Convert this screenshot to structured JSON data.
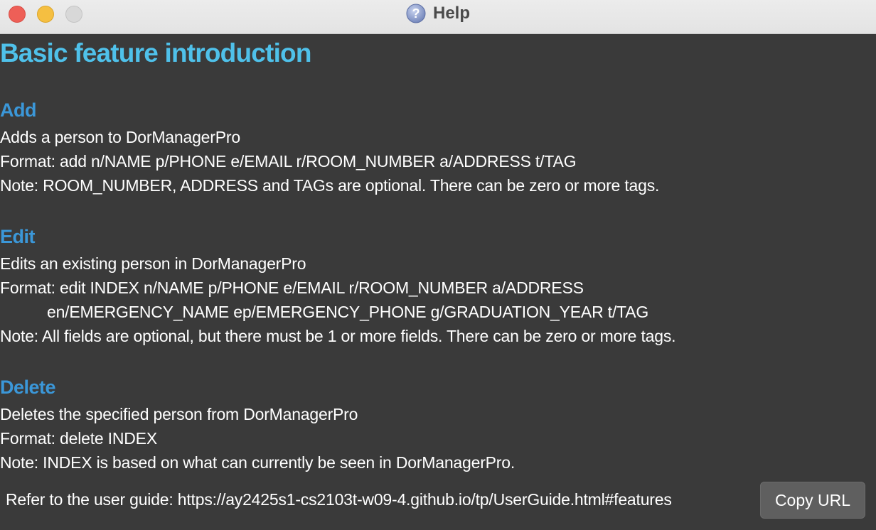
{
  "window": {
    "title": "Help",
    "icon": "help-question-icon"
  },
  "colors": {
    "page_title": "#4fc1ea",
    "section_heading": "#3b97d8",
    "background": "#3a3a3a",
    "text": "#ffffff",
    "button_bg": "#5f5f5f"
  },
  "content": {
    "title": "Basic feature introduction",
    "sections": [
      {
        "heading": "Add",
        "lines": [
          "Adds a person to DorManagerPro",
          "Format: add n/NAME p/PHONE e/EMAIL r/ROOM_NUMBER a/ADDRESS t/TAG",
          "Note: ROOM_NUMBER, ADDRESS and TAGs are optional. There can be zero or more tags."
        ]
      },
      {
        "heading": "Edit",
        "lines": [
          "Edits an existing person in DorManagerPro",
          "Format: edit INDEX n/NAME p/PHONE e/EMAIL r/ROOM_NUMBER a/ADDRESS",
          "en/EMERGENCY_NAME ep/EMERGENCY_PHONE g/GRADUATION_YEAR t/TAG",
          "Note: All fields are optional, but there must be 1 or more fields. There can be zero or more tags."
        ]
      },
      {
        "heading": "Delete",
        "lines": [
          "Deletes the specified person from DorManagerPro",
          "Format: delete INDEX",
          "Note: INDEX is based on what can currently be seen in DorManagerPro."
        ]
      }
    ]
  },
  "footer": {
    "url_text": "Refer to the user guide: https://ay2425s1-cs2103t-w09-4.github.io/tp/UserGuide.html#features",
    "copy_button_label": "Copy URL"
  }
}
